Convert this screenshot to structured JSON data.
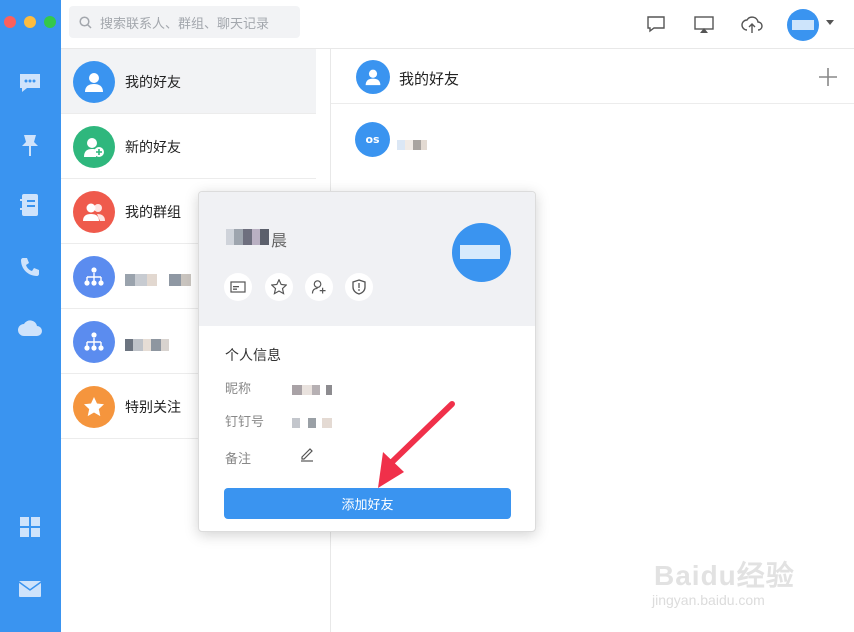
{
  "search": {
    "placeholder": "搜索联系人、群组、聊天记录"
  },
  "contacts": {
    "items": [
      {
        "label": "我的好友",
        "icon": "user-icon",
        "color": "#3a94f0"
      },
      {
        "label": "新的好友",
        "icon": "user-add-icon",
        "color": "#2fb77d"
      },
      {
        "label": "我的群组",
        "icon": "group-icon",
        "color": "#ef5a4c"
      },
      {
        "label": "",
        "icon": "org-icon",
        "color": "#5b8cef"
      },
      {
        "label": "",
        "icon": "org-icon",
        "color": "#5b8cef"
      },
      {
        "label": "特别关注",
        "icon": "star-icon",
        "color": "#f5953d"
      }
    ]
  },
  "panel": {
    "title": "我的好友",
    "friend_initials": "os"
  },
  "card": {
    "name_tail": "晨",
    "section_title": "个人信息",
    "fields": {
      "nickname": "昵称",
      "dingtalk_id": "钉钉号",
      "note": "备注"
    },
    "add_friend": "添加好友"
  },
  "watermark": {
    "brand": "Baidu经验",
    "site": "jingyan.baidu.com"
  },
  "colors": {
    "accent": "#3a94f0",
    "arrow": "#f0304a"
  }
}
